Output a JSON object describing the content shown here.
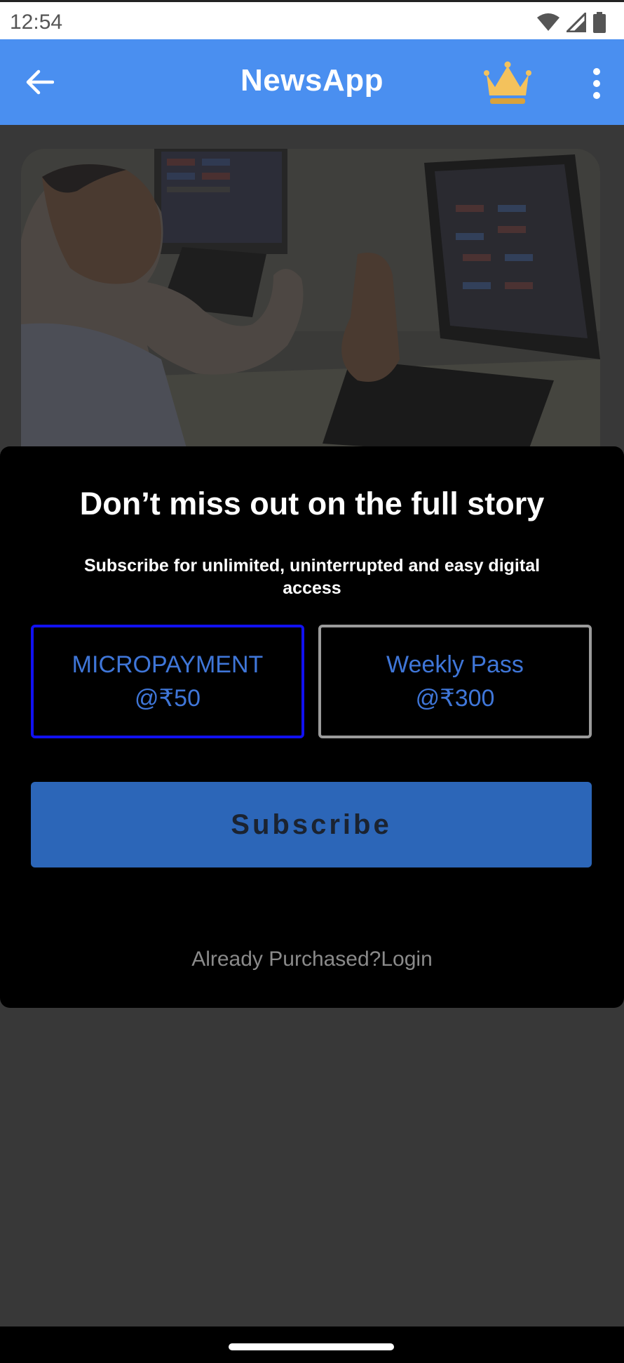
{
  "status_bar": {
    "time": "12:54",
    "icons": [
      "wifi-icon",
      "cellular-signal-icon",
      "battery-icon"
    ]
  },
  "app_bar": {
    "title": "NewsApp",
    "back_icon": "arrow-left-icon",
    "premium_icon": "crown-icon",
    "menu_icon": "more-vertical-icon",
    "color": "#4a8ff0"
  },
  "hero": {
    "image": "photo of a man cheering in front of stock market trading screens"
  },
  "paywall": {
    "title": "Don’t miss out on the full story",
    "subtitle": "Subscribe for unlimited, uninterrupted and easy digital access",
    "plans": [
      {
        "name": "MICROPAYMENT",
        "price": "@₹50",
        "selected": true
      },
      {
        "name": "Weekly Pass",
        "price": "@₹300",
        "selected": false
      }
    ],
    "subscribe_label": "Subscribe",
    "login_text": "Already Purchased?Login",
    "accent_color": "#2c66b8",
    "selected_border_color": "#1111f0"
  }
}
